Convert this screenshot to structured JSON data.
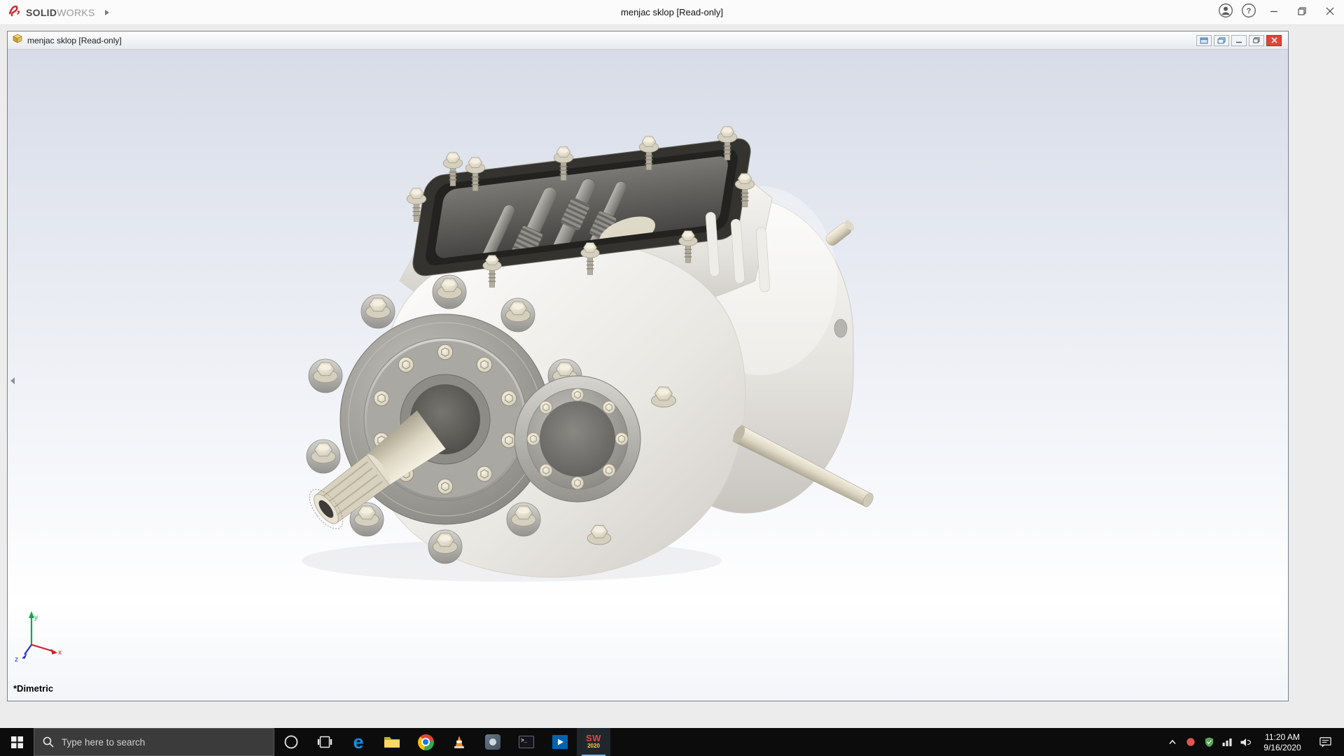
{
  "app": {
    "brand_bold": "SOLID",
    "brand_light": "WORKS",
    "title": "menjac sklop [Read-only]"
  },
  "document": {
    "title": "menjac sklop [Read-only]",
    "view_label": "*Dimetric",
    "axes": {
      "x": "x",
      "y": "y",
      "z": "z"
    }
  },
  "taskbar": {
    "search_placeholder": "Type here to search",
    "solidworks_letters": "SW",
    "solidworks_badge": "2020",
    "tray": {
      "time": "11:20 AM",
      "date": "9/16/2020"
    }
  },
  "icons": {
    "edge_glyph": "e",
    "help_glyph": "?",
    "terminal_glyph": ">_"
  },
  "colors": {
    "brand_red": "#d02027",
    "close_red": "#e0443a",
    "taskbar": "#0c0c0c",
    "active_indicator": "#76b9ed",
    "viewport_top": "#d7dce8",
    "triad_x": "#cc2222",
    "triad_y": "#18a24b",
    "triad_z": "#2233cc"
  }
}
